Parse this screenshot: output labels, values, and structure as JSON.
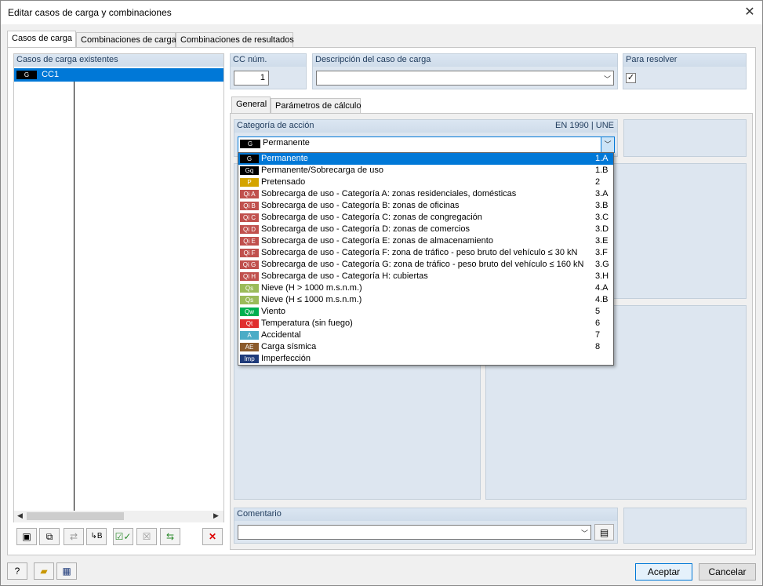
{
  "window": {
    "title": "Editar casos de carga y combinaciones"
  },
  "tabs": [
    {
      "label": "Casos de carga"
    },
    {
      "label": "Combinaciones de carga"
    },
    {
      "label": "Combinaciones de resultados"
    }
  ],
  "left": {
    "header": "Casos de carga existentes",
    "rows": [
      {
        "tag": "G",
        "name": "CC1"
      }
    ]
  },
  "cc": {
    "label": "CC núm.",
    "value": "1"
  },
  "desc": {
    "label": "Descripción del caso de carga",
    "value": ""
  },
  "solve": {
    "label": "Para resolver"
  },
  "subtabs": [
    {
      "label": "General"
    },
    {
      "label": "Parámetros de cálculo"
    }
  ],
  "action": {
    "label": "Categoría de acción",
    "norm": "EN 1990 | UNE",
    "selected_tag": "G",
    "selected_text": "Permanente"
  },
  "dropdown": [
    {
      "tag": "G",
      "color": "#000000",
      "text": "Permanente",
      "code": "1.A"
    },
    {
      "tag": "Gq",
      "color": "#000000",
      "text": "Permanente/Sobrecarga de uso",
      "code": "1.B"
    },
    {
      "tag": "P",
      "color": "#d4a400",
      "text": "Pretensado",
      "code": "2"
    },
    {
      "tag": "Qi A",
      "color": "#c0504d",
      "text": "Sobrecarga de uso - Categoría A: zonas residenciales, domésticas",
      "code": "3.A"
    },
    {
      "tag": "Qi B",
      "color": "#c0504d",
      "text": "Sobrecarga de uso - Categoría B: zonas de oficinas",
      "code": "3.B"
    },
    {
      "tag": "Qi C",
      "color": "#c0504d",
      "text": "Sobrecarga de uso - Categoría C: zonas de congregación",
      "code": "3.C"
    },
    {
      "tag": "Qi D",
      "color": "#c0504d",
      "text": "Sobrecarga de uso - Categoría D: zonas de comercios",
      "code": "3.D"
    },
    {
      "tag": "Qi E",
      "color": "#c0504d",
      "text": "Sobrecarga de uso - Categoría E: zonas de almacenamiento",
      "code": "3.E"
    },
    {
      "tag": "Qi F",
      "color": "#c0504d",
      "text": "Sobrecarga de uso - Categoría F: zona de tráfico - peso bruto del vehículo ≤ 30 kN",
      "code": "3.F"
    },
    {
      "tag": "Qi G",
      "color": "#c0504d",
      "text": "Sobrecarga de uso - Categoría G: zona de tráfico - peso bruto del vehículo ≤ 160 kN",
      "code": "3.G"
    },
    {
      "tag": "Qi H",
      "color": "#c0504d",
      "text": "Sobrecarga de uso - Categoría H: cubiertas",
      "code": "3.H"
    },
    {
      "tag": "Qs",
      "color": "#9bbb59",
      "text": "Nieve (H > 1000 m.s.n.m.)",
      "code": "4.A"
    },
    {
      "tag": "Qs",
      "color": "#9bbb59",
      "text": "Nieve (H ≤ 1000 m.s.n.m.)",
      "code": "4.B"
    },
    {
      "tag": "Qw",
      "color": "#00b050",
      "text": "Viento",
      "code": "5"
    },
    {
      "tag": "Qt",
      "color": "#e03030",
      "text": "Temperatura (sin fuego)",
      "code": "6"
    },
    {
      "tag": "A",
      "color": "#4bacc6",
      "text": "Accidental",
      "code": "7"
    },
    {
      "tag": "AE",
      "color": "#8b5a2b",
      "text": "Carga sísmica",
      "code": "8"
    },
    {
      "tag": "Imp",
      "color": "#1f3b7a",
      "text": "Imperfección",
      "code": ""
    }
  ],
  "comment": {
    "label": "Comentario",
    "value": ""
  },
  "buttons": {
    "ok": "Aceptar",
    "cancel": "Cancelar"
  },
  "icons": {
    "help": "help-icon",
    "open": "open-folder-icon",
    "save": "save-icon",
    "new": "new-case-icon",
    "copy": "copy-icon",
    "renumber": "renumber-icon",
    "b": "subscript-b-icon",
    "check": "check-all-icon",
    "uncheck": "uncheck-all-icon",
    "swap": "swap-icon",
    "delete": "delete-icon"
  }
}
